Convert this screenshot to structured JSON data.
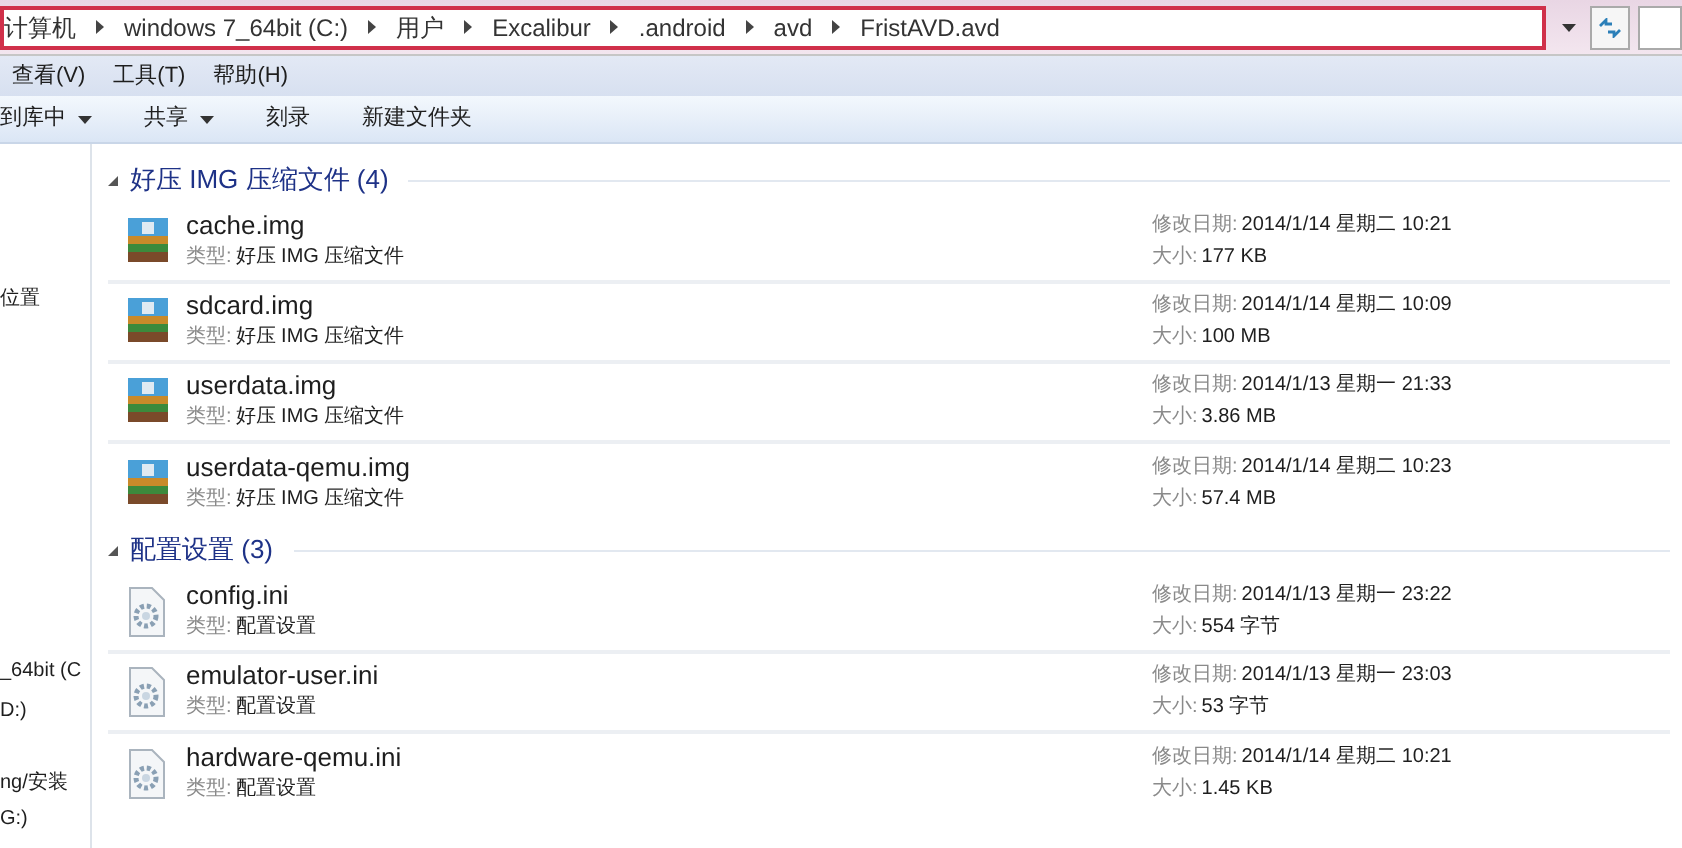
{
  "address_bar": {
    "segments": [
      "计算机",
      "windows 7_64bit (C:)",
      "用户",
      "Excalibur",
      ".android",
      "avd",
      "FristAVD.avd"
    ]
  },
  "menu": [
    "查看(V)",
    "工具(T)",
    "帮助(H)"
  ],
  "toolbar": [
    {
      "label": "到库中",
      "dropdown": true
    },
    {
      "label": "共享",
      "dropdown": true
    },
    {
      "label": "刻录",
      "dropdown": false
    },
    {
      "label": "新建文件夹",
      "dropdown": false
    }
  ],
  "sidebar": {
    "items": [
      {
        "label": "位置"
      },
      {
        "label": "_64bit (C"
      },
      {
        "label": "D:)"
      },
      {
        "label": "ng/安装"
      },
      {
        "label": "G:)"
      }
    ]
  },
  "groups": [
    {
      "title": "好压 IMG 压缩文件 (4)",
      "expanded": true,
      "kind": "archive",
      "files": [
        {
          "name": "cache.img",
          "type_label": "类型:",
          "type": "好压 IMG 压缩文件",
          "date_label": "修改日期:",
          "date": "2014/1/14 星期二 10:21",
          "size_label": "大小:",
          "size": "177 KB"
        },
        {
          "name": "sdcard.img",
          "type_label": "类型:",
          "type": "好压 IMG 压缩文件",
          "date_label": "修改日期:",
          "date": "2014/1/14 星期二 10:09",
          "size_label": "大小:",
          "size": "100 MB"
        },
        {
          "name": "userdata.img",
          "type_label": "类型:",
          "type": "好压 IMG 压缩文件",
          "date_label": "修改日期:",
          "date": "2014/1/13 星期一 21:33",
          "size_label": "大小:",
          "size": "3.86 MB"
        },
        {
          "name": "userdata-qemu.img",
          "type_label": "类型:",
          "type": "好压 IMG 压缩文件",
          "date_label": "修改日期:",
          "date": "2014/1/14 星期二 10:23",
          "size_label": "大小:",
          "size": "57.4 MB"
        }
      ]
    },
    {
      "title": "配置设置 (3)",
      "expanded": true,
      "kind": "config",
      "files": [
        {
          "name": "config.ini",
          "type_label": "类型:",
          "type": "配置设置",
          "date_label": "修改日期:",
          "date": "2014/1/13 星期一 23:22",
          "size_label": "大小:",
          "size": "554 字节"
        },
        {
          "name": "emulator-user.ini",
          "type_label": "类型:",
          "type": "配置设置",
          "date_label": "修改日期:",
          "date": "2014/1/13 星期一 23:03",
          "size_label": "大小:",
          "size": "53 字节"
        },
        {
          "name": "hardware-qemu.ini",
          "type_label": "类型:",
          "type": "配置设置",
          "date_label": "修改日期:",
          "date": "2014/1/14 星期二 10:21",
          "size_label": "大小:",
          "size": "1.45 KB"
        }
      ]
    }
  ]
}
